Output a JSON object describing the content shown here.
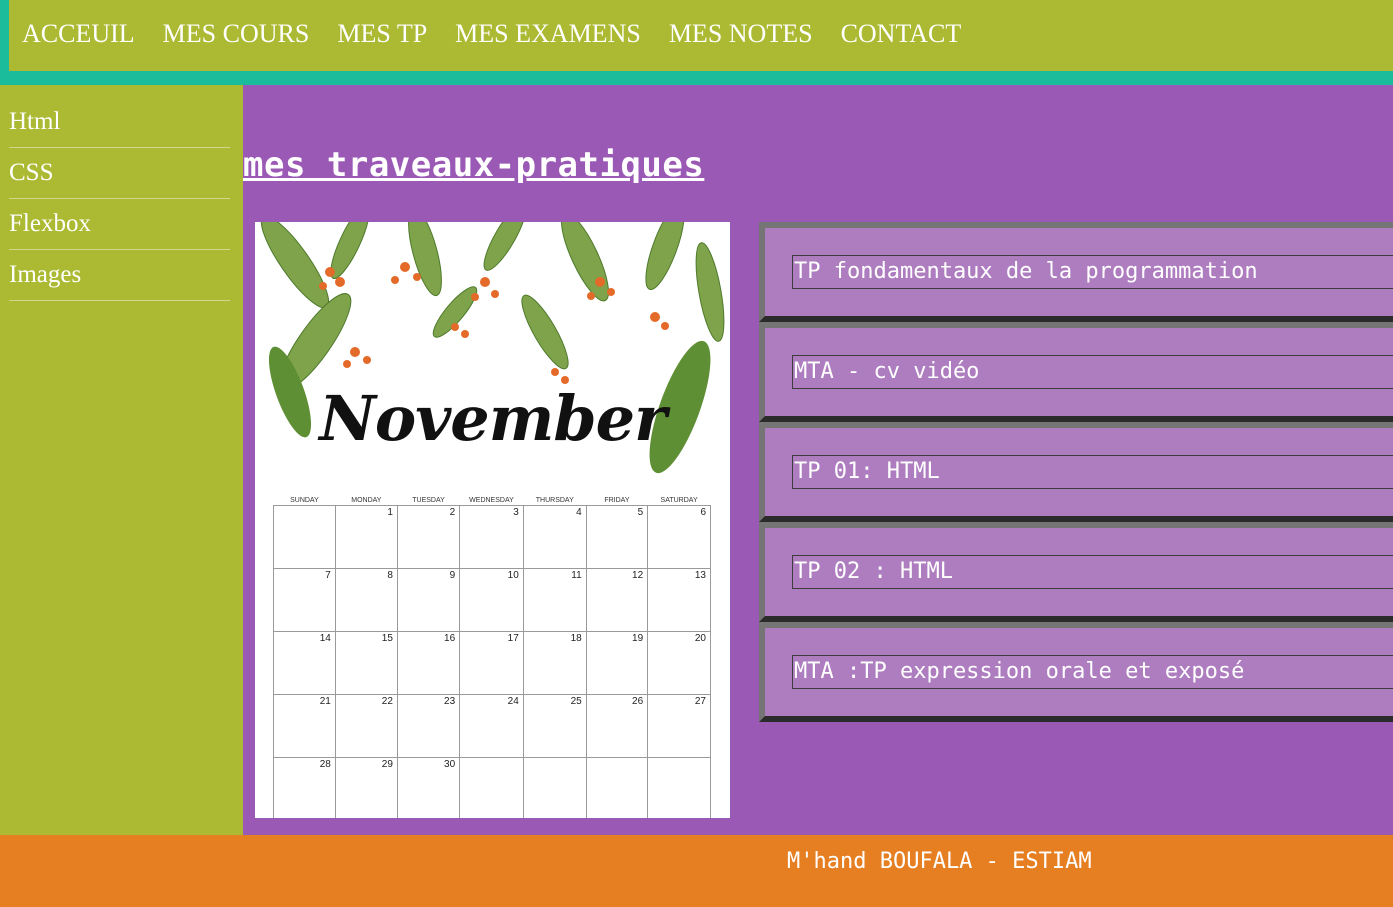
{
  "nav": {
    "items": [
      "ACCEUIL",
      "MES COURS",
      "MES TP",
      "MES EXAMENS",
      "MES NOTES",
      "CONTACT"
    ]
  },
  "sidebar": {
    "items": [
      "Html",
      "CSS",
      "Flexbox",
      "Images"
    ]
  },
  "main": {
    "title": "mes traveaux-pratiques",
    "calendar_image": {
      "month": "November",
      "weekdays": [
        "SUNDAY",
        "MONDAY",
        "TUESDAY",
        "WEDNESDAY",
        "THURSDAY",
        "FRIDAY",
        "SATURDAY"
      ],
      "weeks": [
        [
          "",
          "1",
          "2",
          "3",
          "4",
          "5",
          "6"
        ],
        [
          "7",
          "8",
          "9",
          "10",
          "11",
          "12",
          "13"
        ],
        [
          "14",
          "15",
          "16",
          "17",
          "18",
          "19",
          "20"
        ],
        [
          "21",
          "22",
          "23",
          "24",
          "25",
          "26",
          "27"
        ],
        [
          "28",
          "29",
          "30",
          "",
          "",
          "",
          ""
        ]
      ]
    },
    "tp_items": [
      "TP fondamentaux de la programmation",
      "MTA - cv vidéo",
      "TP 01: HTML",
      "TP 02 : HTML",
      "MTA :TP expression orale et exposé"
    ]
  },
  "footer": {
    "text": "M'hand BOUFALA - ESTIAM"
  },
  "colors": {
    "nav_bg": "#abba32",
    "nav_border": "#1abc9c",
    "main_bg": "#9b59b6",
    "card_bg": "#ae7dbf",
    "footer_bg": "#e67e22"
  }
}
